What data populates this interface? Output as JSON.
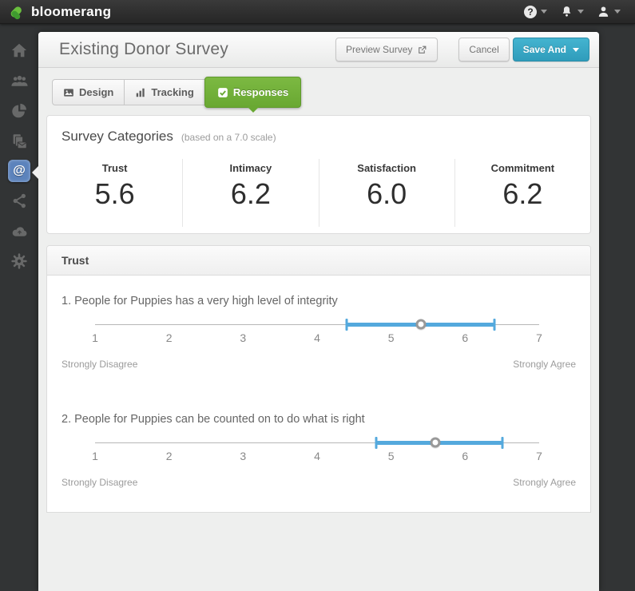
{
  "topbar": {
    "brand": "bloomerang",
    "icons": [
      {
        "name": "help-icon",
        "glyph": "?"
      },
      {
        "name": "notifications-icon"
      },
      {
        "name": "user-icon"
      }
    ]
  },
  "sidebar": {
    "items": [
      {
        "name": "home",
        "icon": "home-icon",
        "active": false
      },
      {
        "name": "constituents",
        "icon": "people-icon",
        "active": false
      },
      {
        "name": "reports",
        "icon": "pie-chart-icon",
        "active": false
      },
      {
        "name": "letters",
        "icon": "documents-icon",
        "active": false
      },
      {
        "name": "email",
        "icon": "at-sign-icon",
        "active": true,
        "glyph": "@"
      },
      {
        "name": "share",
        "icon": "share-icon",
        "active": false
      },
      {
        "name": "sync",
        "icon": "cloud-icon",
        "active": false
      },
      {
        "name": "settings",
        "icon": "gear-icon",
        "active": false
      }
    ]
  },
  "header": {
    "title": "Existing Donor Survey",
    "preview_label": "Preview Survey",
    "cancel_label": "Cancel",
    "save_label": "Save And"
  },
  "tabs": [
    {
      "label": "Design",
      "icon": "image-icon",
      "active": false
    },
    {
      "label": "Tracking",
      "icon": "bar-chart-icon",
      "active": false
    },
    {
      "label": "Responses",
      "icon": "checkbox-icon",
      "active": true
    }
  ],
  "categories": {
    "title": "Survey Categories",
    "subtitle": "(based on a 7.0 scale)",
    "scale_max": 7.0,
    "items": [
      {
        "label": "Trust",
        "value": "5.6"
      },
      {
        "label": "Intimacy",
        "value": "6.2"
      },
      {
        "label": "Satisfaction",
        "value": "6.0"
      },
      {
        "label": "Commitment",
        "value": "6.2"
      }
    ]
  },
  "section": {
    "title": "Trust",
    "questions": [
      {
        "text": "1. People for Puppies has a very high level of integrity",
        "scale_min": 1,
        "scale_max": 7,
        "left_label": "Strongly Disagree",
        "right_label": "Strongly Agree",
        "range_low": 4.4,
        "range_high": 6.4,
        "marker": 5.4
      },
      {
        "text": "2. People for Puppies can be counted on to do what is right",
        "scale_min": 1,
        "scale_max": 7,
        "left_label": "Strongly Disagree",
        "right_label": "Strongly Agree",
        "range_low": 4.8,
        "range_high": 6.5,
        "marker": 5.6
      }
    ]
  },
  "colors": {
    "brand_green": "#6abf3e",
    "brand_green_dark": "#3f9a2f",
    "tab_green": "#7cb942",
    "tab_green_dark": "#69a832",
    "save_teal": "#44b4d0",
    "save_teal_dark": "#2f9cbb",
    "slider_blue": "#54a9dd",
    "active_icon_blue": "#5c83bc"
  }
}
